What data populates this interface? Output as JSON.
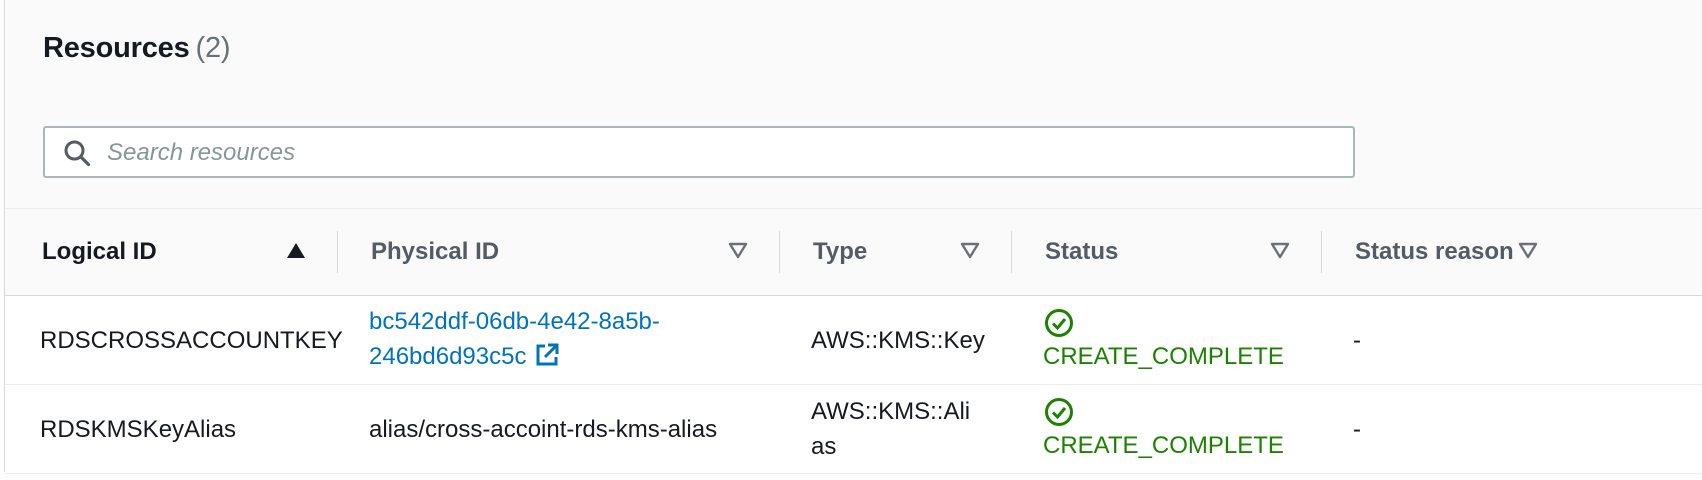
{
  "header": {
    "title": "Resources",
    "count": "(2)"
  },
  "search": {
    "placeholder": "Search resources",
    "icon": "search-icon"
  },
  "table": {
    "columns": [
      {
        "label": "Logical ID",
        "sort": "ascending"
      },
      {
        "label": "Physical ID",
        "sort": "none"
      },
      {
        "label": "Type",
        "sort": "none"
      },
      {
        "label": "Status",
        "sort": "none"
      },
      {
        "label": "Status reason",
        "sort": "none"
      }
    ],
    "rows": [
      {
        "logical_id": "RDSCROSSACCOUNTKEY",
        "physical_id_line1": "bc542ddf-06db-4e42-8a5b-",
        "physical_id_line2": "246bd6d93c5c",
        "physical_id_is_link": true,
        "type": "AWS::KMS::Key",
        "status": "CREATE_COMPLETE",
        "status_reason": "-"
      },
      {
        "logical_id": "RDSKMSKeyAlias",
        "physical_id": "alias/cross-accoint-rds-kms-alias",
        "physical_id_is_link": false,
        "type": "AWS::KMS::Alias",
        "status": "CREATE_COMPLETE",
        "status_reason": "-"
      }
    ]
  },
  "colors": {
    "link": "#0073bb",
    "success": "#1d8102",
    "text": "#16191f",
    "muted": "#545b64"
  }
}
